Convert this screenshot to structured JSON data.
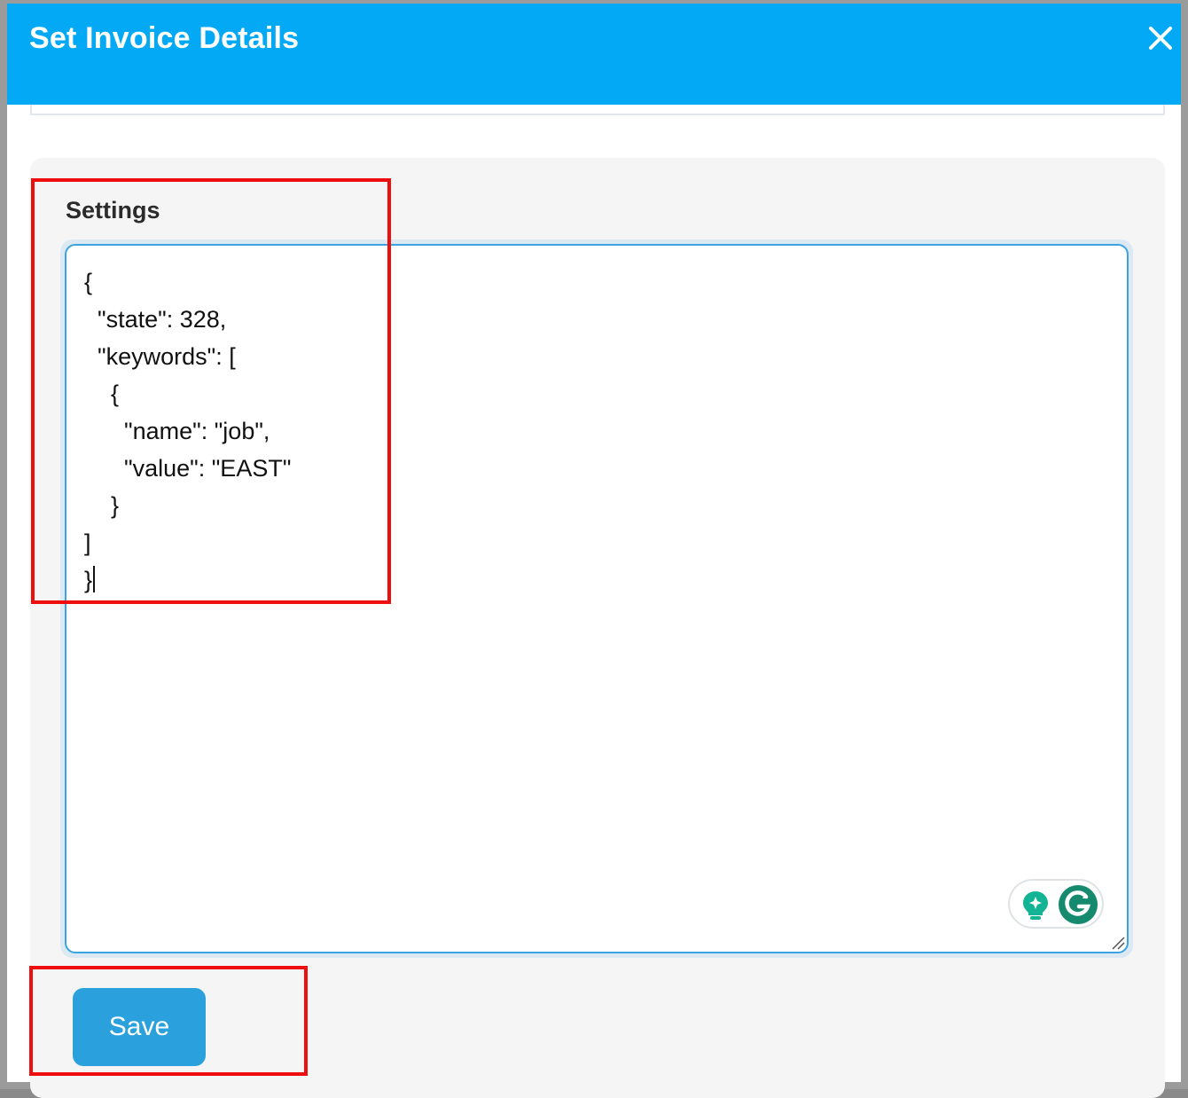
{
  "dialog": {
    "title": "Set Invoice Details",
    "close_icon": "close-icon"
  },
  "settings": {
    "label": "Settings",
    "json_text": "{\n  \"state\": 328,\n  \"keywords\": [\n    {\n      \"name\": \"job\",\n      \"value\": \"EAST\"\n    }\n]\n}"
  },
  "grammarly": {
    "assist_icon": "lightbulb-icon",
    "logo_icon": "grammarly-icon"
  },
  "actions": {
    "save_label": "Save"
  },
  "colors": {
    "header": "#03a9f4",
    "save_button": "#2aa0dc",
    "highlight": "#ee0e0e",
    "panel_bg": "#f5f5f5"
  }
}
